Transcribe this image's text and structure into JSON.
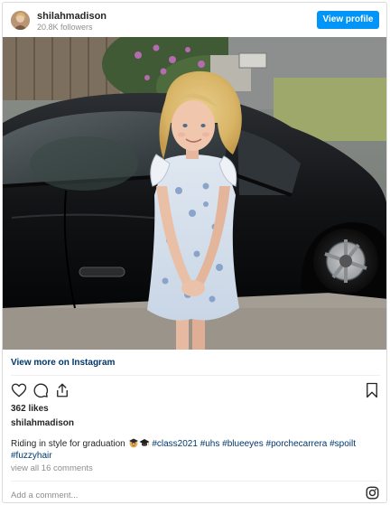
{
  "header": {
    "username": "shilahmadison",
    "followers": "20.8K followers",
    "view_profile_label": "View profile"
  },
  "post": {
    "view_more_label": "View more on Instagram",
    "likes": "362 likes",
    "caption_username": "shilahmadison",
    "caption_text": "Riding in style for graduation ",
    "caption_emojis": [
      "graduate-emoji",
      "graduation-cap-emoji"
    ],
    "hashtags": [
      "#class2021",
      "#uhs",
      "#blueeyes",
      "#porchecarrera",
      "#spoilt",
      "#fuzzyhair"
    ],
    "view_comments": "view all 16 comments"
  },
  "comment": {
    "placeholder": "Add a comment..."
  },
  "icons": {
    "like": "heart-icon",
    "comment": "comment-bubble-icon",
    "share": "share-icon",
    "save": "bookmark-icon",
    "instagram": "instagram-icon"
  },
  "colors": {
    "accent": "#0095f6",
    "link": "#00376b",
    "muted": "#8e8e8e",
    "border": "#dbdbdb"
  }
}
